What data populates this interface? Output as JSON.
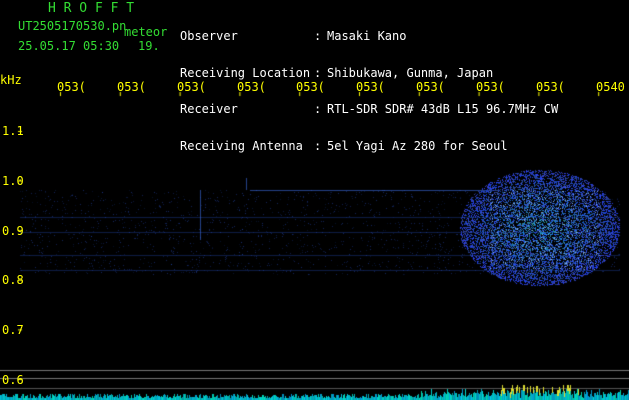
{
  "header": {
    "app_name": "H R O F F T",
    "filename": "UT2505170530.pn",
    "meteor_label": "meteor",
    "datetime": "25.05.17 05:30",
    "meteor_count": "19."
  },
  "meta": {
    "items": [
      {
        "label": "Observer",
        "value": "Masaki Kano"
      },
      {
        "label": "Receiving Location",
        "value": "Shibukawa, Gunma, Japan"
      },
      {
        "label": "Receiver",
        "value": "RTL-SDR SDR# 43dB L15 96.7MHz CW"
      },
      {
        "label": "Receiving Antenna",
        "value": "5el Yagi Az 280 for Seoul"
      }
    ],
    "separator": ":"
  },
  "axes": {
    "y_unit": "kHz",
    "y_ticks": [
      "1.1",
      "1.0",
      "0.9",
      "0.8",
      "0.7",
      "0.6"
    ],
    "x_ticks": [
      "053(",
      "053(",
      "053(",
      "053(",
      "053(",
      "053(",
      "053(",
      "053(",
      "053(",
      "0540"
    ]
  },
  "colors": {
    "background": "#000000",
    "axis_text": "#ffff00",
    "title": "#33dd33",
    "signal": "#3a7bff",
    "guide_line": "#888888"
  }
}
